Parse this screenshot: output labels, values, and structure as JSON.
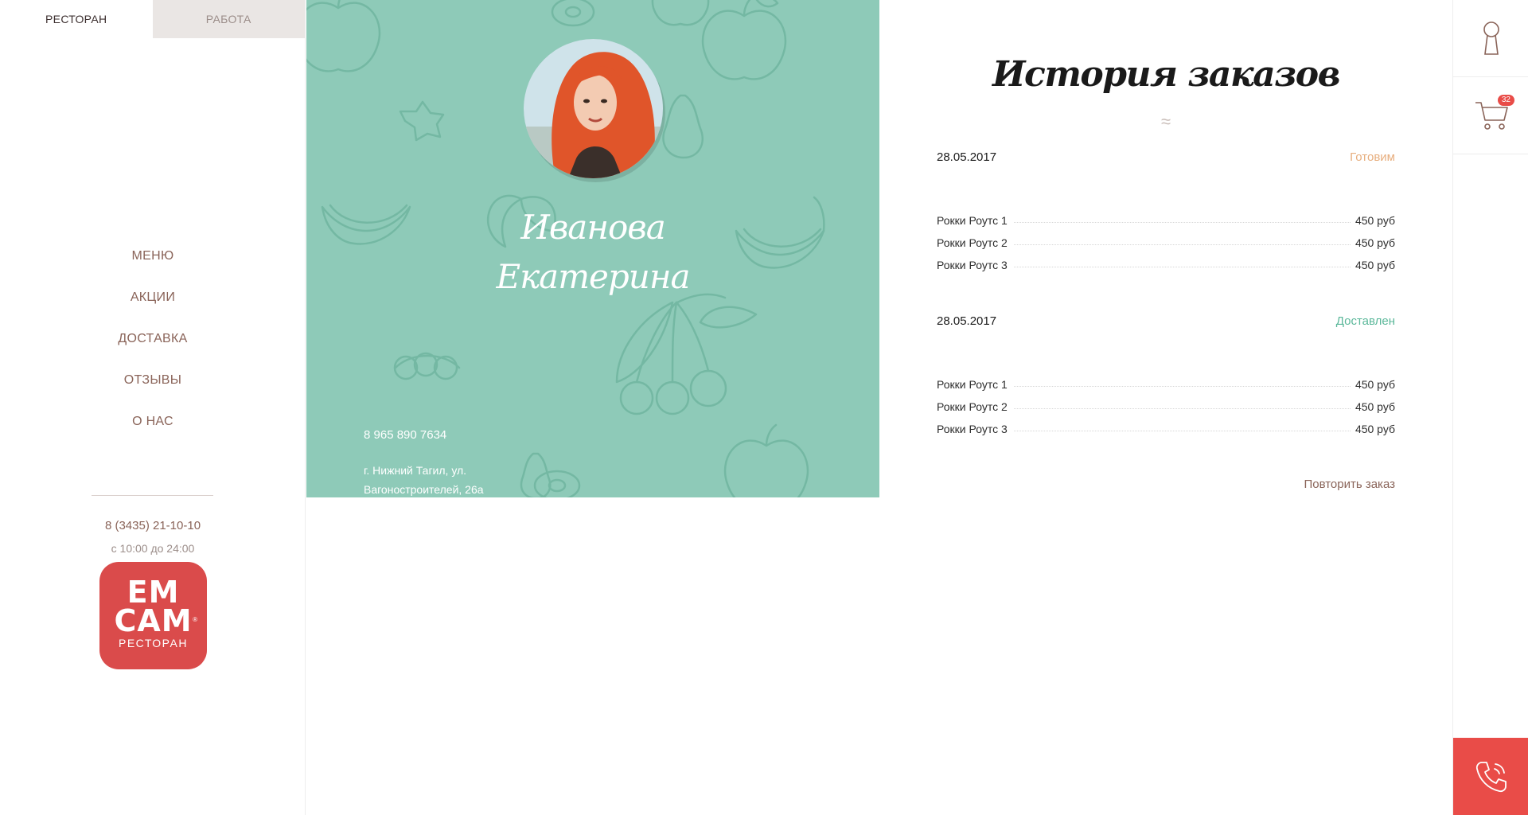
{
  "tabs": [
    {
      "label": "РЕСТОРАН"
    },
    {
      "label": "РАБОТА"
    }
  ],
  "nav": {
    "items": [
      {
        "label": "МЕНЮ"
      },
      {
        "label": "АКЦИИ"
      },
      {
        "label": "ДОСТАВКА"
      },
      {
        "label": "ОТЗЫВЫ"
      },
      {
        "label": "О НАС"
      }
    ]
  },
  "contact": {
    "phone": "8 (3435) 21-10-10",
    "hours": "с 10:00 до 24:00"
  },
  "logo": {
    "line1": "EM",
    "line2": "CAM",
    "sub": "РЕСТОРАН",
    "reg": "®"
  },
  "profile": {
    "last_name": "Иванова",
    "first_name": "Екатерина",
    "phone": "8 965 890 7634",
    "address": "г. Нижний Тагил, ул. Вагоностроителей, 26а"
  },
  "orders": {
    "title": "История заказов",
    "list": [
      {
        "date": "28.05.2017",
        "status": "Готовим",
        "items": [
          {
            "name": "Рокки Роутс 1",
            "price": "450 руб"
          },
          {
            "name": "Рокки Роутс 2",
            "price": "450 руб"
          },
          {
            "name": "Рокки Роутс 3",
            "price": "450 руб"
          }
        ]
      },
      {
        "date": "28.05.2017",
        "status": "Доставлен",
        "items": [
          {
            "name": "Рокки Роутс 1",
            "price": "450 руб"
          },
          {
            "name": "Рокки Роутс 2",
            "price": "450 руб"
          },
          {
            "name": "Рокки Роутс 3",
            "price": "450 руб"
          }
        ]
      }
    ],
    "repeat_label": "Повторить заказ"
  },
  "cart": {
    "count": "32"
  },
  "colors": {
    "accent_red": "#e94c48",
    "profile_bg": "#8ecab8",
    "status_cooking": "#e7ae7e",
    "status_delivered": "#5bb89a",
    "link_brown": "#8a6459"
  },
  "icons": [
    "key-icon",
    "cart-icon",
    "phone-icon",
    "fruit-pattern"
  ]
}
